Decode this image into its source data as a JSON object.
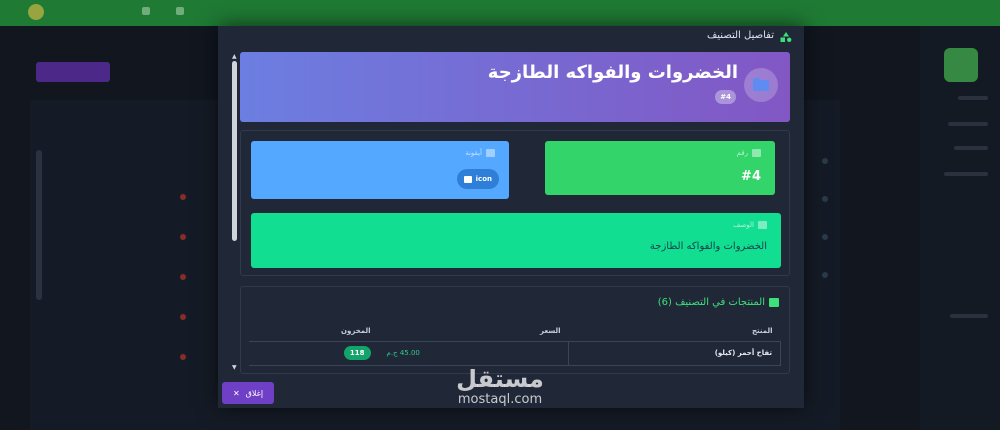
{
  "background": {
    "topbar_color": "#1f7a34",
    "sidebar_accent": "#3fa54a"
  },
  "modal": {
    "title": "تفاصيل التصنيف",
    "title_icon": "shapes-icon",
    "hero": {
      "title": "الخضروات والفواكه الطازجة",
      "badge": "#4",
      "avatar_icon": "folder-icon",
      "gradient": [
        "#6c7ee1",
        "#8257c4"
      ]
    },
    "cards": {
      "id_label": "رقم",
      "id_value": "#4",
      "icon_label": "أيقونة",
      "icon_value": "icon",
      "desc_label": "الوصف",
      "desc_value": "الخضروات والفواكه الطازجة"
    },
    "products": {
      "title": "المنتجات في التصنيف (6)",
      "columns": [
        "المنتج",
        "السعر",
        "المخزون"
      ],
      "rows": [
        {
          "name": "تفاح أحمر (كيلو)",
          "price": "45.00 ج.م",
          "stock": "118"
        }
      ]
    },
    "close_label": "إغلاق"
  },
  "watermark": {
    "arabic": "مستقل",
    "latin": "mostaql.com"
  }
}
